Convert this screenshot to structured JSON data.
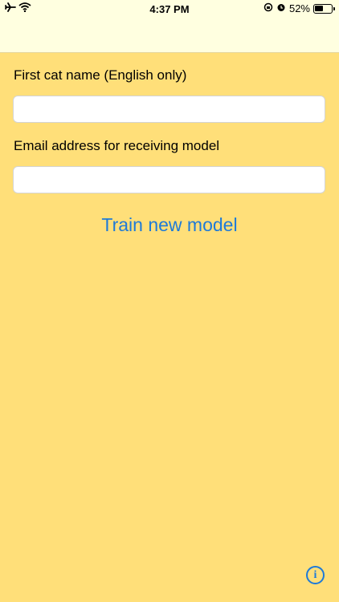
{
  "status_bar": {
    "time": "4:37 PM",
    "battery_percent": "52%",
    "battery_level": 0.52,
    "icons": [
      "airplane-icon",
      "wifi-icon",
      "orientation-lock-icon",
      "alarm-icon",
      "battery-icon"
    ]
  },
  "form": {
    "cat_name_label": "First cat name (English only)",
    "cat_name_value": "",
    "email_label": "Email address for receiving model",
    "email_value": ""
  },
  "actions": {
    "train_label": "Train new model",
    "info_glyph": "i"
  },
  "colors": {
    "background": "#FFDF79",
    "nav_background": "#FFFFE0",
    "accent": "#1E7AD8"
  }
}
